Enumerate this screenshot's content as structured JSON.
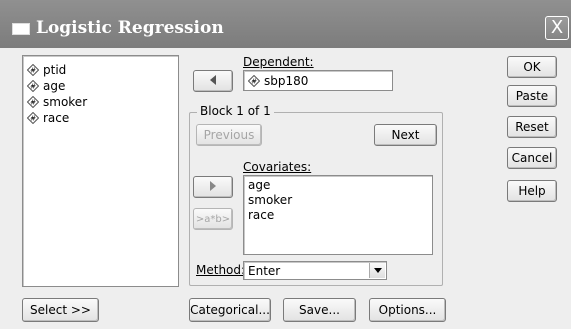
{
  "window": {
    "title": "Logistic Regression",
    "close_label": "X"
  },
  "variables": [
    {
      "name": "ptid"
    },
    {
      "name": "age"
    },
    {
      "name": "smoker"
    },
    {
      "name": "race"
    }
  ],
  "dependent": {
    "label": "Dependent:",
    "value": "sbp180"
  },
  "block": {
    "label": "Block 1 of 1",
    "previous_label": "Previous",
    "next_label": "Next"
  },
  "covariates": {
    "label": "Covariates:",
    "items": [
      "age",
      "smoker",
      "race"
    ],
    "interaction_label": ">a*b>"
  },
  "method": {
    "label": "Method:",
    "value": "Enter"
  },
  "buttons": {
    "ok": "OK",
    "paste": "Paste",
    "reset": "Reset",
    "cancel": "Cancel",
    "help": "Help",
    "select": "Select >>",
    "categorical": "Categorical...",
    "save": "Save...",
    "options": "Options..."
  },
  "icons": {
    "variable": "scale-variable-icon",
    "move": "arrow-icon"
  }
}
